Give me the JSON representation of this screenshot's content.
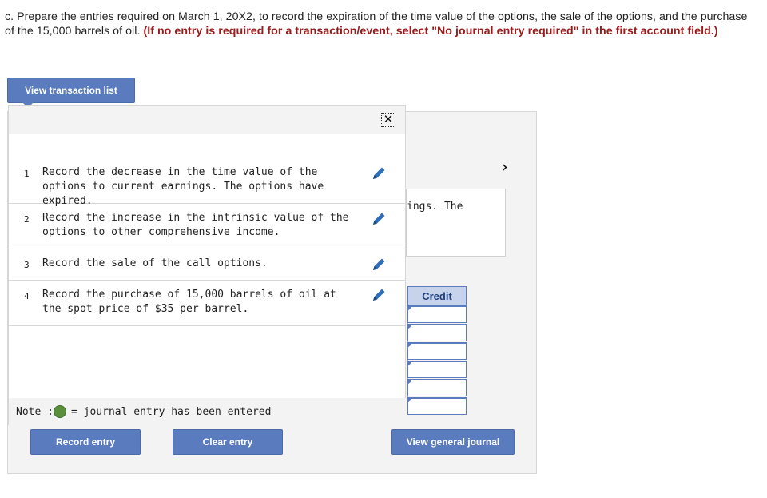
{
  "question": {
    "text": "c. Prepare the entries required on March 1, 20X2, to record the expiration of the time value of the options, the sale of the options, and the purchase of the 15,000 barrels of oil. ",
    "instruction": "(If no entry is required for a transaction/event, select \"No journal entry required\" in the first account field.)"
  },
  "buttons": {
    "view_transaction_list": "View transaction list",
    "record_entry": "Record entry",
    "clear_entry": "Clear entry",
    "view_general_journal": "View general journal"
  },
  "background": {
    "description_fragment": "ings. The",
    "credit_header": "Credit",
    "next_arrow": "›"
  },
  "popup": {
    "close_glyph": "✕",
    "transactions": [
      {
        "num": "1",
        "text": "Record the decrease in the time value of the options to current earnings. The options have expired."
      },
      {
        "num": "2",
        "text": "Record the increase in the intrinsic value of the options to other comprehensive income."
      },
      {
        "num": "3",
        "text": "Record the sale of the call options."
      },
      {
        "num": "4",
        "text": "Record the purchase of 15,000 barrels of oil at the spot price of $35 per barrel."
      }
    ],
    "note_label": "Note :",
    "note_text": "= journal entry has been entered"
  },
  "colors": {
    "accent": "#5a7bbd",
    "instruction": "#9b1b1b",
    "entered_dot": "#5a8f3b"
  },
  "icons": [
    "pencil-icon",
    "close-icon",
    "chevron-right-icon"
  ]
}
